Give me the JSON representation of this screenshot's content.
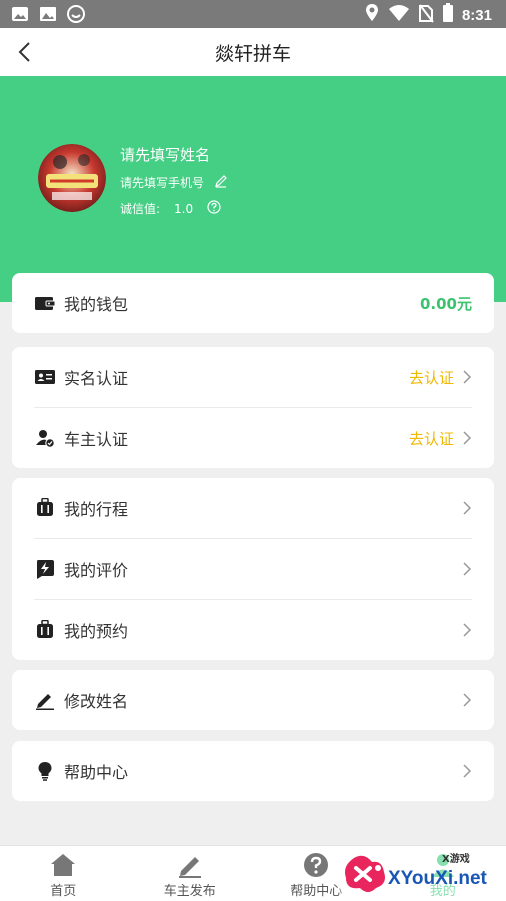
{
  "status_bar": {
    "time": "8:31"
  },
  "header": {
    "title": "燚轩拼车"
  },
  "profile": {
    "name": "请先填写姓名",
    "phone": "请先填写手机号",
    "credit_label": "诚信值:",
    "credit_value": "1.0"
  },
  "wallet": {
    "label": "我的钱包",
    "amount": "0.00元"
  },
  "verification": [
    {
      "label": "实名认证",
      "action": "去认证"
    },
    {
      "label": "车主认证",
      "action": "去认证"
    }
  ],
  "trips": [
    {
      "label": "我的行程"
    },
    {
      "label": "我的评价"
    },
    {
      "label": "我的预约"
    }
  ],
  "edit_name": {
    "label": "修改姓名"
  },
  "help": {
    "label": "帮助中心"
  },
  "tabs": [
    {
      "label": "首页"
    },
    {
      "label": "车主发布"
    },
    {
      "label": "帮助中心"
    },
    {
      "label": "我的"
    }
  ],
  "watermark": {
    "top": "X游戏",
    "brand": "XYouXi.net"
  },
  "colors": {
    "accent": "#45cf84",
    "action": "#f0b800",
    "amount": "#3cc36f"
  }
}
